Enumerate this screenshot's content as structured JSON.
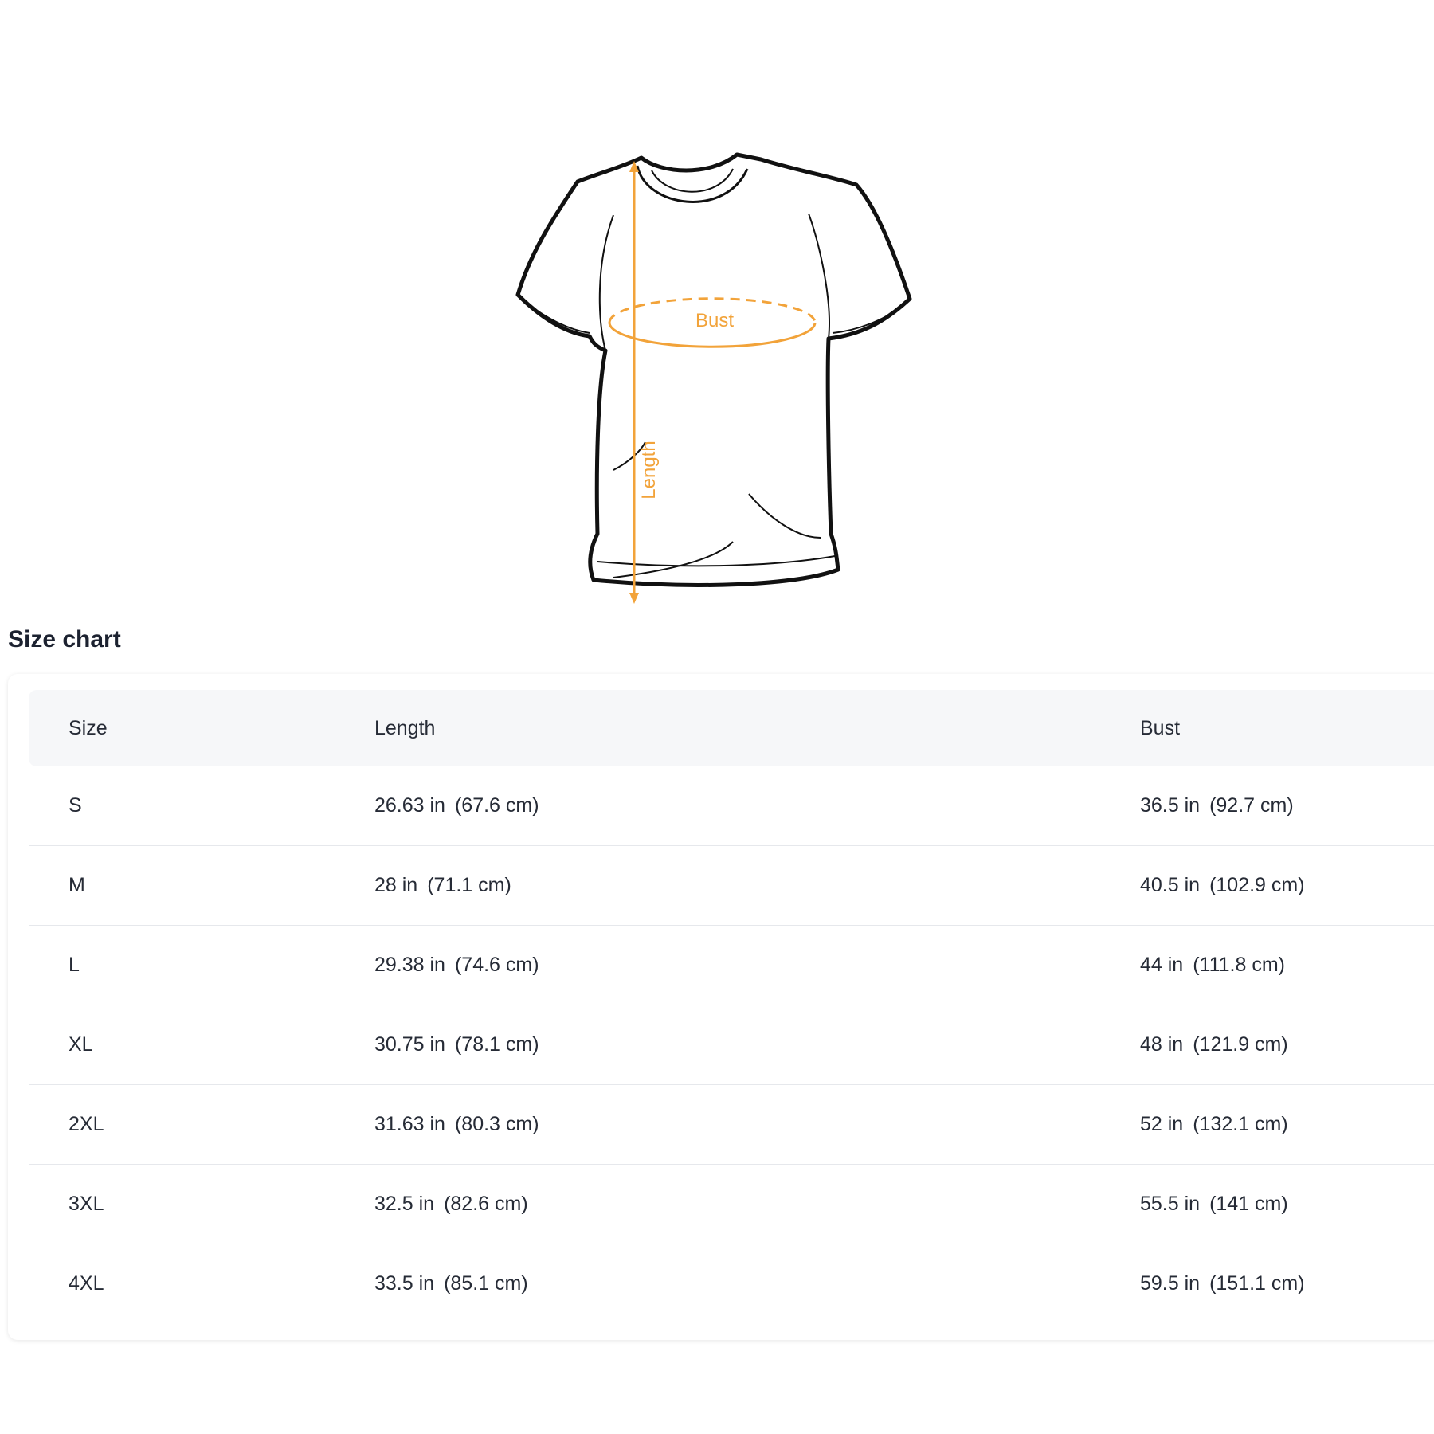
{
  "diagram": {
    "bust_label": "Bust",
    "length_label": "Length",
    "accent_color": "#f2a33a"
  },
  "size_chart": {
    "title": "Size chart",
    "headers": [
      "Size",
      "Length",
      "Bust"
    ],
    "rows": [
      {
        "size": "S",
        "length_in": "26.63 in",
        "length_cm": "(67.6 cm)",
        "bust_in": "36.5 in",
        "bust_cm": "(92.7 cm)"
      },
      {
        "size": "M",
        "length_in": "28 in",
        "length_cm": "(71.1 cm)",
        "bust_in": "40.5 in",
        "bust_cm": "(102.9 cm)"
      },
      {
        "size": "L",
        "length_in": "29.38 in",
        "length_cm": "(74.6 cm)",
        "bust_in": "44 in",
        "bust_cm": "(111.8 cm)"
      },
      {
        "size": "XL",
        "length_in": "30.75 in",
        "length_cm": "(78.1 cm)",
        "bust_in": "48 in",
        "bust_cm": "(121.9 cm)"
      },
      {
        "size": "2XL",
        "length_in": "31.63 in",
        "length_cm": "(80.3 cm)",
        "bust_in": "52 in",
        "bust_cm": "(132.1 cm)"
      },
      {
        "size": "3XL",
        "length_in": "32.5 in",
        "length_cm": "(82.6 cm)",
        "bust_in": "55.5 in",
        "bust_cm": "(141 cm)"
      },
      {
        "size": "4XL",
        "length_in": "33.5 in",
        "length_cm": "(85.1 cm)",
        "bust_in": "59.5 in",
        "bust_cm": "(151.1 cm)"
      }
    ]
  }
}
